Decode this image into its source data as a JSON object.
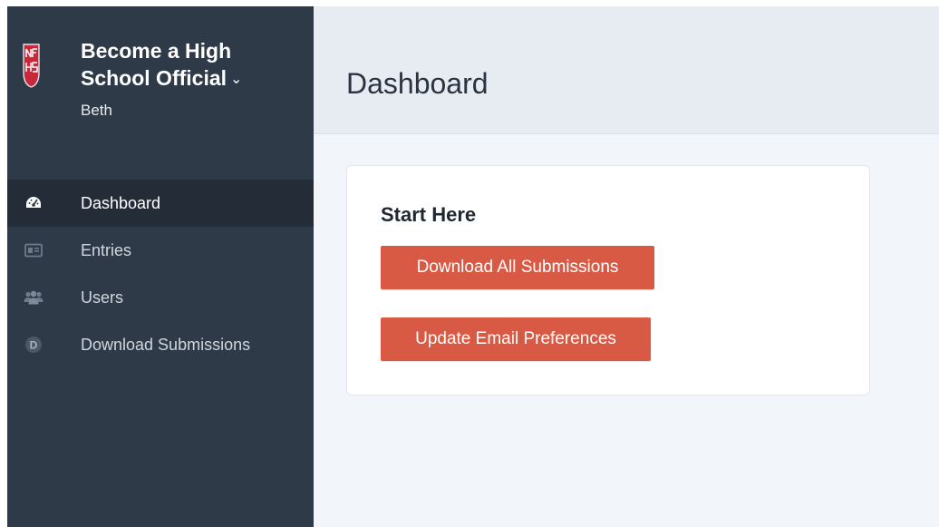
{
  "brand": {
    "title": "Become a High School Official",
    "chevron": "⌄",
    "user": "Beth",
    "logo_icon": "nfhs-logo"
  },
  "nav": {
    "items": [
      {
        "label": "Dashboard",
        "icon": "dashboard-gauge-icon",
        "active": true
      },
      {
        "label": "Entries",
        "icon": "id-card-icon",
        "active": false
      },
      {
        "label": "Users",
        "icon": "users-icon",
        "active": false
      },
      {
        "label": "Download Submissions",
        "icon": "letter-d-icon",
        "icon_text": "D",
        "active": false
      }
    ]
  },
  "header": {
    "title": "Dashboard"
  },
  "card": {
    "title": "Start Here",
    "download_button": "Download All Submissions",
    "email_button": "Update Email Preferences"
  },
  "colors": {
    "sidebar_bg": "#2f3a48",
    "sidebar_active_bg": "#232c37",
    "header_bg": "#e7ecf2",
    "content_bg": "#f2f5f9",
    "button_bg": "#d95a44"
  }
}
